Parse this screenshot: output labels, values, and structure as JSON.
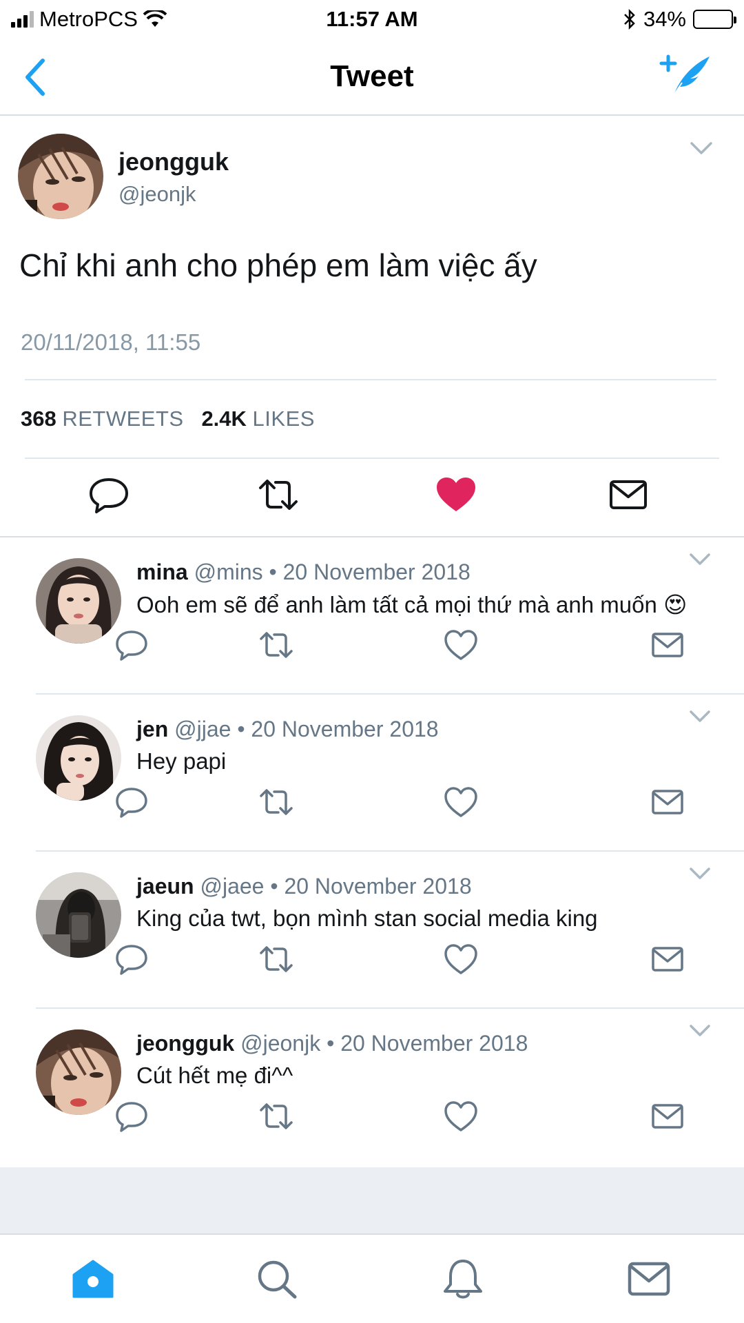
{
  "status_bar": {
    "carrier": "MetroPCS",
    "time": "11:57 AM",
    "battery": "34%",
    "battery_level": 0.34
  },
  "nav": {
    "title": "Tweet",
    "icons": {
      "back": "back-chevron-icon",
      "compose": "compose-tweet-icon"
    }
  },
  "main_tweet": {
    "name": "jeongguk",
    "handle": "@jeonjk",
    "text": "Chỉ khi anh cho phép em làm việc ấy",
    "timestamp": "20/11/2018, 11:55",
    "retweets_count": "368",
    "retweets_label": "RETWEETS",
    "likes_count": "2.4K",
    "likes_label": "LIKES",
    "liked": true,
    "colors": {
      "like": "#e0245e"
    }
  },
  "replies": [
    {
      "name": "mina",
      "handle": "@mins",
      "date": "20 November 2018",
      "text": "Ooh em sẽ để anh làm tất cả mọi thứ mà anh muốn 😍"
    },
    {
      "name": "jen",
      "handle": "@jjae",
      "date": "20 November 2018",
      "text": "Hey papi"
    },
    {
      "name": "jaeun",
      "handle": "@jaee",
      "date": "20 November 2018",
      "text": "King của twt, bọn mình stan social media king"
    },
    {
      "name": "jeongguk",
      "handle": "@jeonjk",
      "date": "20 November 2018",
      "text": "Cút hết mẹ đi^^"
    }
  ],
  "separator": " • ",
  "tabbar": {
    "items": [
      "home-icon",
      "search-icon",
      "notifications-icon",
      "messages-icon"
    ],
    "active": "home-icon",
    "colors": {
      "active": "#1da1f2",
      "inactive": "#657786"
    }
  },
  "colors": {
    "accent": "#1da1f2",
    "secondary_text": "#657786"
  }
}
